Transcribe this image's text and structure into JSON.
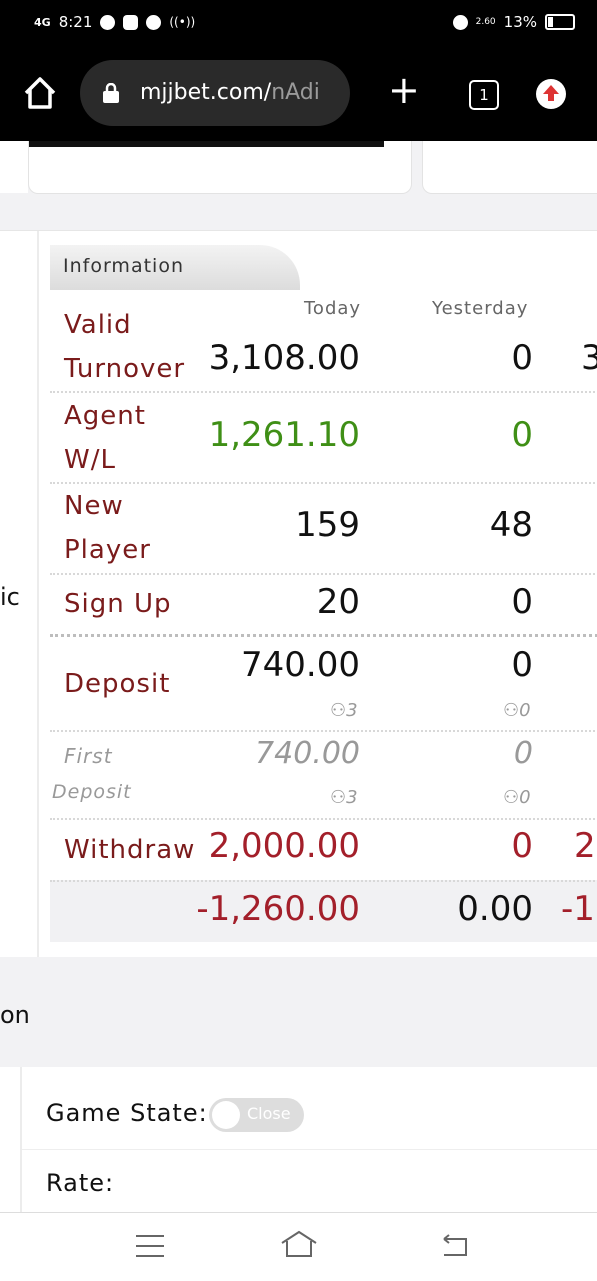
{
  "status_bar": {
    "network": "4G",
    "time": "8:21",
    "speed": "2.60",
    "battery": "13%"
  },
  "browser": {
    "url_main": "mjjbet.com/",
    "url_faded": "nAdi",
    "tab_count": "1"
  },
  "info": {
    "tab_label": "Information",
    "headers": {
      "today": "Today",
      "yesterday": "Yesterday"
    },
    "rows": {
      "valid_turnover": {
        "label1": "Valid",
        "label2": "Turnover",
        "today": "3,108.00",
        "yesterday": "0",
        "extra": "3"
      },
      "agent_wl": {
        "label1": "Agent",
        "label2": "W/L",
        "today": "1,261.10",
        "yesterday": "0"
      },
      "new_player": {
        "label1": "New",
        "label2": "Player",
        "today": "159",
        "yesterday": "48"
      },
      "sign_up": {
        "label": "Sign Up",
        "today": "20",
        "yesterday": "0"
      },
      "deposit": {
        "label": "Deposit",
        "today": "740.00",
        "yesterday": "0",
        "today_count": "3",
        "yesterday_count": "0"
      },
      "first_deposit": {
        "label1": "First",
        "label2": "Deposit",
        "today": "740.00",
        "yesterday": "0",
        "today_count": "3",
        "yesterday_count": "0"
      },
      "withdraw": {
        "label": "Withdraw",
        "today": "2,000.00",
        "yesterday": "0",
        "extra": "2."
      },
      "total": {
        "today": "-1,260.00",
        "yesterday": "0.00",
        "extra": "-1."
      }
    }
  },
  "left_fragment": "ic",
  "section_fragment": "on",
  "settings": {
    "game_state_label": "Game State:",
    "toggle_text": "Close",
    "rate_label": "Rate:"
  }
}
